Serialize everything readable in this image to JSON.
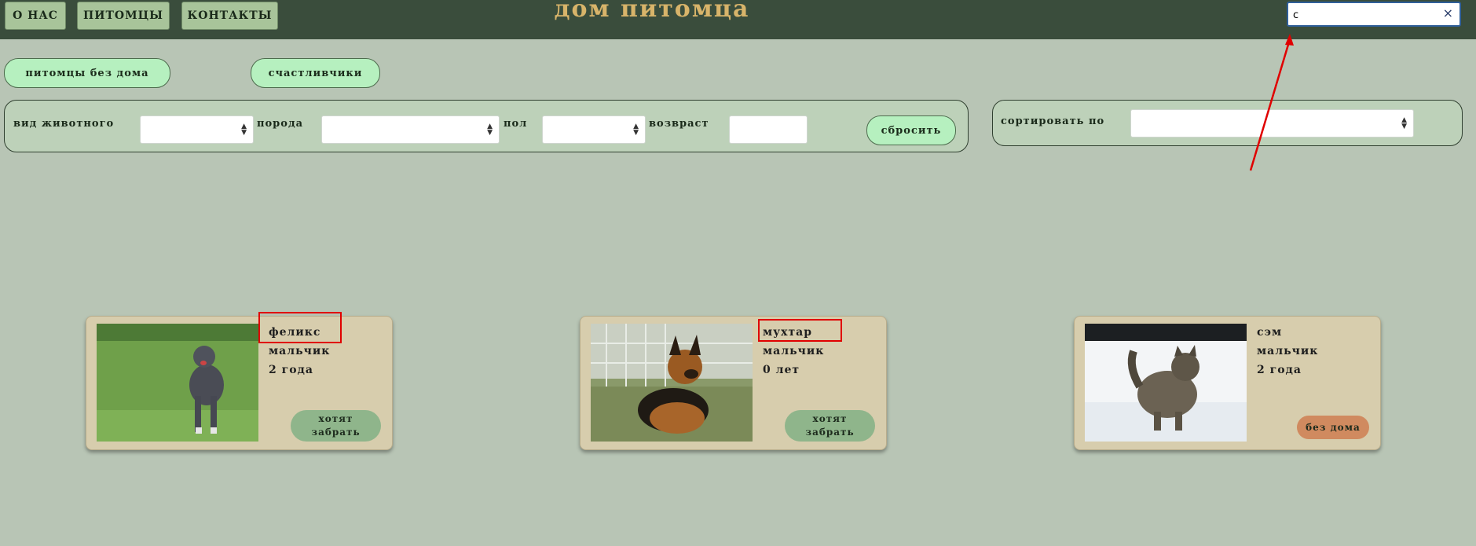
{
  "nav": {
    "items": [
      {
        "label": "о нас"
      },
      {
        "label": "питомцы"
      },
      {
        "label": "контакты"
      }
    ],
    "title": "дом питомца"
  },
  "search": {
    "value": "с",
    "clear_symbol": "×"
  },
  "filter_tabs": [
    {
      "label": "питомцы без дома"
    },
    {
      "label": "счастливчики"
    }
  ],
  "filters": {
    "species_label": "вид животного",
    "breed_label": "порода",
    "gender_label": "пол",
    "age_label": "возвраст",
    "reset_label": "сбросить",
    "species_value": "",
    "breed_value": "",
    "gender_value": "",
    "age_value": ""
  },
  "sort": {
    "label": "сортировать по",
    "value": ""
  },
  "pets": [
    {
      "name": "феликс",
      "gender": "мальчик",
      "age": "2 года",
      "status": "хотят забрать",
      "status_color": "#8fb58b",
      "photo": "pitbull-photo"
    },
    {
      "name": "мухтар",
      "gender": "мальчик",
      "age": "0 лет",
      "status": "хотят забрать",
      "status_color": "#8fb58b",
      "photo": "shepherd-puppy-photo"
    },
    {
      "name": "сэм",
      "gender": "мальчик",
      "age": "2 года",
      "status": "без дома",
      "status_color": "#d08a5f",
      "photo": "cat-in-snow-photo"
    }
  ],
  "colors": {
    "topbar": "#3a4d3c",
    "title": "#d8b46a",
    "background": "#b8c5b5",
    "card": "#d7cdad",
    "pill": "#b6f0bf",
    "annotation": "#e00000"
  }
}
